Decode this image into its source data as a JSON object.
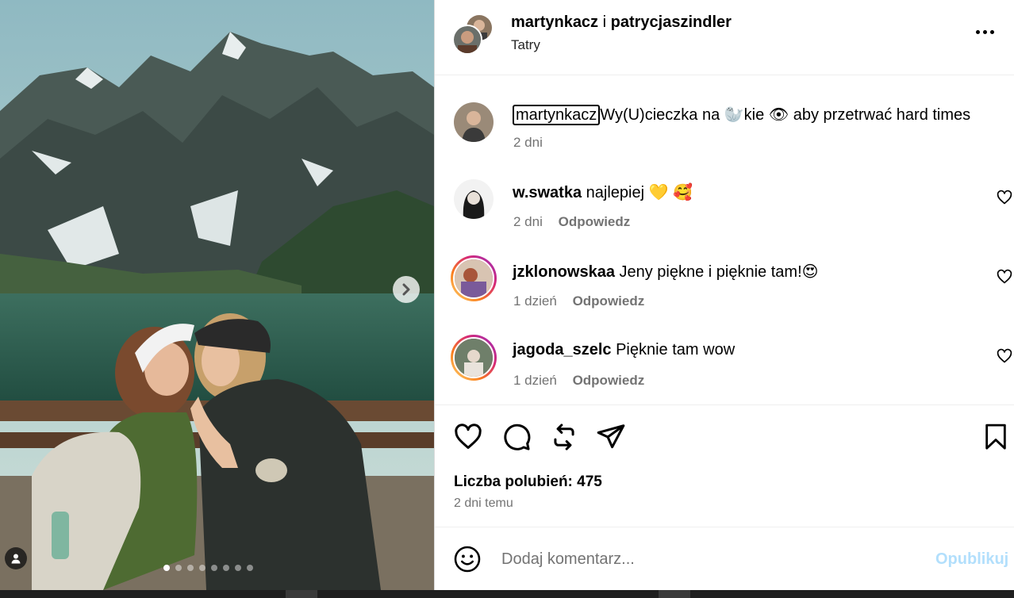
{
  "post": {
    "author": "martynkacz",
    "connector": "i",
    "collaborator": "patrycjaszindler",
    "location": "Tatry",
    "caption": {
      "username": "martynkacz",
      "text_before": "Wy(U)cieczka na ",
      "emoji_seal": "🦭",
      "text_mid": "kie ",
      "emoji_eye": "👁",
      "text_after": "  aby przetrwać hard times",
      "time": "2 dni"
    },
    "carousel": {
      "current_index": 0,
      "total": 8
    }
  },
  "comments": [
    {
      "username": "w.swatka",
      "text": "najlepiej 💛 🥰",
      "time": "2 dni",
      "reply_label": "Odpowiedz"
    },
    {
      "username": "jzklonowskaa",
      "text": "Jeny piękne i pięknie tam!😍",
      "time": "1 dzień",
      "reply_label": "Odpowiedz"
    },
    {
      "username": "jagoda_szelc",
      "text": "Pięknie tam wow",
      "time": "1 dzień",
      "reply_label": "Odpowiedz"
    }
  ],
  "stats": {
    "likes_label": "Liczba polubień: 475",
    "posted": "2 dni temu"
  },
  "composer": {
    "placeholder": "Dodaj komentarz...",
    "publish_label": "Opublikuj"
  },
  "icons": {
    "like": "heart-icon",
    "comment": "comment-bubble-icon",
    "repost": "repost-icon",
    "share": "send-icon",
    "save": "bookmark-icon",
    "more": "more-options-icon",
    "emoji": "emoji-icon",
    "next": "chevron-right-icon",
    "tag": "user-tag-icon"
  },
  "colors": {
    "publish_disabled": "#b2dffc",
    "secondary_text": "#737373"
  }
}
